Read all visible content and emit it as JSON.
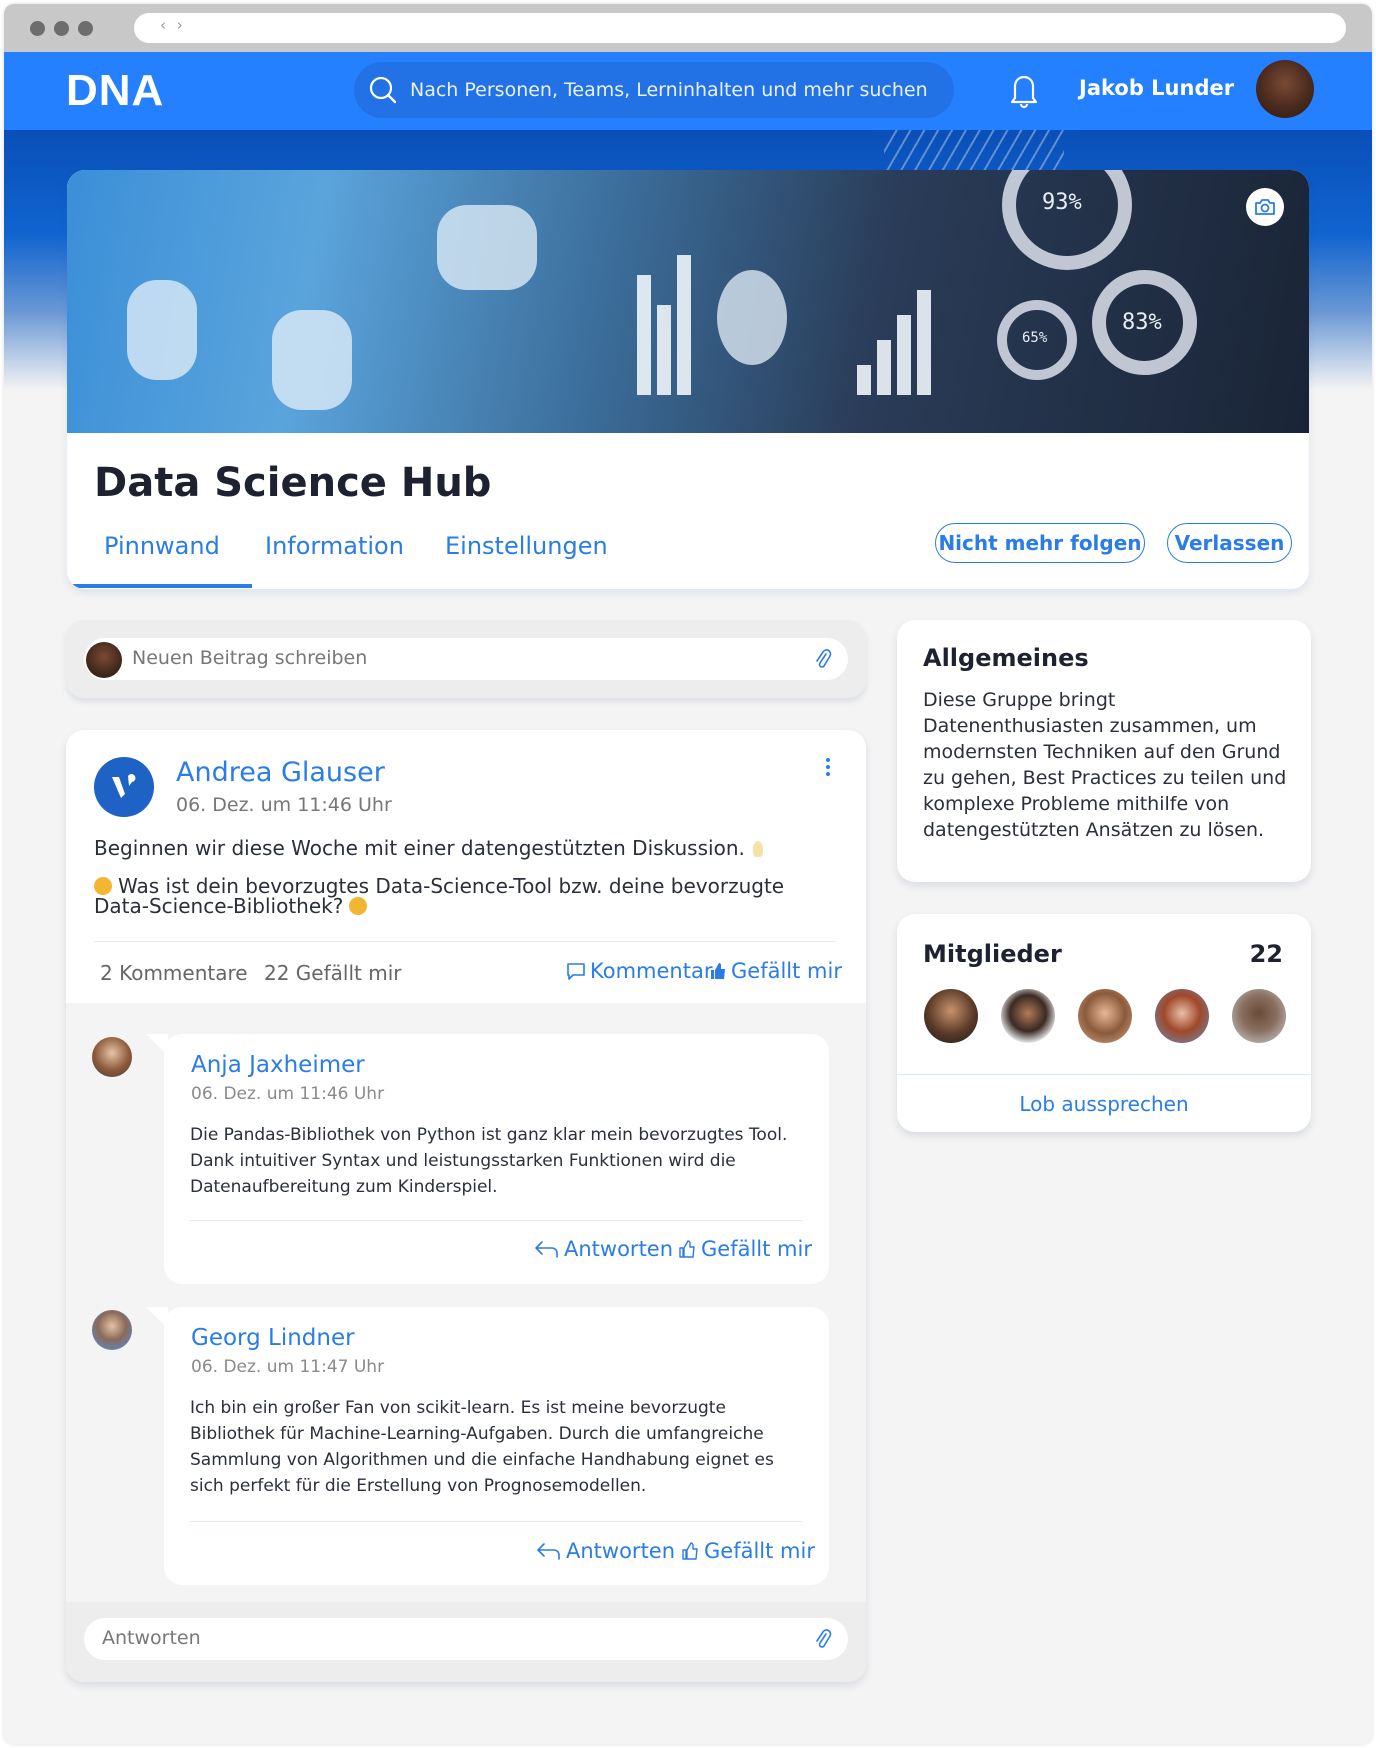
{
  "browser": {
    "nav_arrows": "‹ ›"
  },
  "header": {
    "logo": "DNA",
    "search_placeholder": "Nach Personen, Teams, Lerninhalten und mehr suchen",
    "user_name": "Jakob Lunder",
    "icons": {
      "search": "search-icon",
      "notifications": "bell-icon"
    }
  },
  "group": {
    "title": "Data Science Hub",
    "banner_labels": [
      "93%",
      "83%",
      "65%"
    ],
    "tabs": [
      {
        "label": "Pinnwand",
        "active": true
      },
      {
        "label": "Information",
        "active": false
      },
      {
        "label": "Einstellungen",
        "active": false
      }
    ],
    "actions": {
      "unfollow": "Nicht mehr folgen",
      "leave": "Verlassen"
    }
  },
  "composer": {
    "placeholder": "Neuen Beitrag schreiben"
  },
  "post": {
    "author": "Andrea Glauser",
    "date": "06. Dez. um 11:46 Uhr",
    "text_line1": "Beginnen wir diese Woche mit einer datengestützten Diskussion.",
    "text_line2": "Was ist dein bevorzugtes Data-Science-Tool bzw. deine bevorzugte Data-Science-Bibliothek?",
    "comments_count": "2 Kommentare",
    "likes_count": "22 Gefällt mir",
    "comment_action": "Kommentar",
    "like_action": "Gefällt mir",
    "comments": [
      {
        "author": "Anja Jaxheimer",
        "date": "06. Dez. um 11:46 Uhr",
        "text": "Die Pandas-Bibliothek von Python ist ganz klar mein bevorzugtes Tool. Dank intuitiver Syntax und leistungsstarken Funktionen wird die Datenaufbereitung zum Kinderspiel.",
        "reply": "Antworten",
        "like": "Gefällt mir"
      },
      {
        "author": "Georg Lindner",
        "date": "06. Dez. um 11:47 Uhr",
        "text": "Ich bin ein großer Fan von scikit-learn. Es ist meine bevorzugte Bibliothek für Machine-Learning-Aufgaben. Durch die umfangreiche Sammlung von Algorithmen und die einfache Handhabung eignet es sich perfekt für die Erstellung von Prognosemodellen.",
        "reply": "Antworten",
        "like": "Gefällt mir"
      }
    ],
    "reply_placeholder": "Antworten"
  },
  "sidebar": {
    "about": {
      "title": "Allgemeines",
      "text": "Diese Gruppe bringt Datenenthusiasten zusammen, um modernsten Techniken auf den Grund zu gehen, Best Practices zu teilen und komplexe Probleme mithilfe von datengestützten Ansätzen zu lösen."
    },
    "members": {
      "title": "Mitglieder",
      "count": "22",
      "praise_label": "Lob aussprechen"
    }
  },
  "colors": {
    "brand": "#2580ff",
    "link": "#2a7ce6",
    "text": "#1e2230"
  }
}
